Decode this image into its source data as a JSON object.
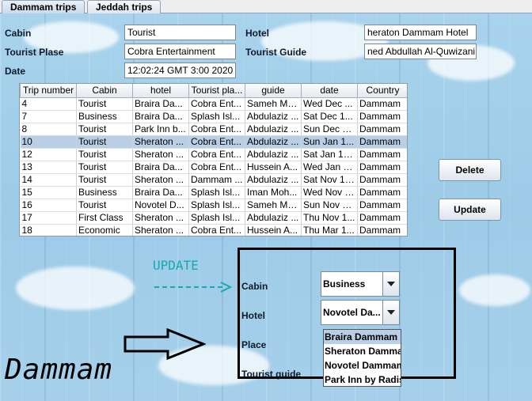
{
  "tabs": [
    "Dammam trips",
    "Jeddah trips"
  ],
  "form": {
    "cabin_label": "Cabin",
    "cabin_value": "Tourist",
    "place_label": "Tourist Plase",
    "place_value": "Cobra Entertainment",
    "date_label": "Date",
    "date_value": "12:02:24 GMT 3:00 2020",
    "hotel_label": "Hotel",
    "hotel_value": "heraton Dammam Hotel",
    "guide_label": "Tourist Guide",
    "guide_value": "ned Abdullah Al-Quwizani"
  },
  "table": {
    "headers": [
      "Trip number",
      "Cabin",
      "hotel",
      "Tourist pla...",
      "guide",
      "date",
      "Country"
    ],
    "rows": [
      [
        "4",
        "Tourist",
        "Braira Da...",
        "Cobra Ent...",
        "Sameh Mo...",
        "Wed Dec ...",
        "Dammam"
      ],
      [
        "7",
        "Business",
        "Braira Da...",
        "Splash Isl...",
        "Abdulaziz ...",
        "Sat Dec 1...",
        "Dammam"
      ],
      [
        "8",
        "Tourist",
        "Park Inn b...",
        "Cobra Ent...",
        "Abdulaziz ...",
        "Sun Dec 1...",
        "Dammam"
      ],
      [
        "10",
        "Tourist",
        "Sheraton ...",
        "Cobra Ent...",
        "Abdulaziz ...",
        "Sun Jan 1...",
        "Dammam"
      ],
      [
        "12",
        "Tourist",
        "Sheraton ...",
        "Cobra Ent...",
        "Abdulaziz ...",
        "Sat Jan 19...",
        "Dammam"
      ],
      [
        "13",
        "Tourist",
        "Braira Da...",
        "Cobra Ent...",
        "Hussein A...",
        "Wed Jan 1...",
        "Dammam"
      ],
      [
        "14",
        "Tourist",
        "Sheraton ...",
        "Dammam ...",
        "Abdulaziz ...",
        "Sat Nov 19...",
        "Dammam"
      ],
      [
        "15",
        "Business",
        "Braira Da...",
        "Splash Isl...",
        "Iman Moh...",
        "Wed Nov 1...",
        "Dammam"
      ],
      [
        "16",
        "Tourist",
        "Novotel D...",
        "Splash Isl...",
        "Sameh Mo...",
        "Sun Nov 1...",
        "Dammam"
      ],
      [
        "17",
        "First Class",
        "Sheraton ...",
        "Splash Isl...",
        "Abdulaziz ...",
        "Thu Nov 1...",
        "Dammam"
      ],
      [
        "18",
        "Economic",
        "Sheraton ...",
        "Cobra Ent...",
        "Hussein A...",
        "Thu Mar 1...",
        "Dammam"
      ]
    ],
    "selected_row_number": "10"
  },
  "buttons": {
    "delete": "Delete",
    "update": "Update"
  },
  "annotation": {
    "update_label": "UPDATE",
    "city_label": "Dammam"
  },
  "update_panel": {
    "cabin_label": "Cabin",
    "cabin_value": "Business",
    "hotel_label": "Hotel",
    "hotel_value": "Novotel Da...",
    "place_label": "Place",
    "guide_label": "Tourist guide",
    "hotel_options": [
      "Braira Dammam",
      "Sheraton Damma",
      "Novotel Dammam",
      "Park Inn by Radis"
    ]
  },
  "colors": {
    "background": "#a6d0ea",
    "selected_row": "#b8cfe5",
    "annotation": "#17a8b0"
  }
}
